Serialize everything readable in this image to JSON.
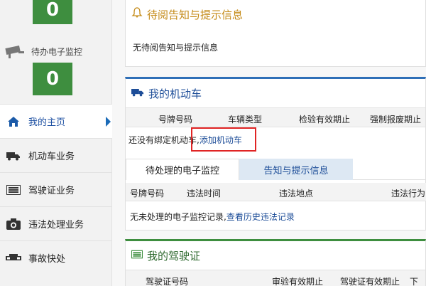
{
  "sidebar": {
    "top_count": "0",
    "monitor_label": "待办电子监控",
    "monitor_count": "0",
    "nav": [
      {
        "label": "我的主页",
        "icon": "home-icon",
        "active": true
      },
      {
        "label": "机动车业务",
        "icon": "truck-icon"
      },
      {
        "label": "驾驶证业务",
        "icon": "id-card-icon"
      },
      {
        "label": "违法处理业务",
        "icon": "camera-icon"
      },
      {
        "label": "事故快处",
        "icon": "car-icon"
      }
    ]
  },
  "notice": {
    "title": "待阅告知与提示信息",
    "content": "无待阅告知与提示信息",
    "icon": "bell-icon",
    "color": "#c48a16"
  },
  "vehicle": {
    "title": "我的机动车",
    "icon": "truck-icon",
    "columns": [
      "号牌号码",
      "车辆类型",
      "检验有效期止",
      "强制报废期止"
    ],
    "empty_text": "还没有绑定机动车,",
    "add_link": "添加机动车",
    "tabs": [
      "待处理的电子监控",
      "告知与提示信息"
    ],
    "monitor_columns": [
      "号牌号码",
      "违法时间",
      "违法地点",
      "违法行为"
    ],
    "monitor_empty": "无未处理的电子监控记录,",
    "history_link": "查看历史违法记录"
  },
  "license": {
    "title": "我的驾驶证",
    "icon": "id-card-icon",
    "columns": [
      "驾驶证号码",
      "审验有效期止",
      "驾驶证有效期止",
      "下一"
    ]
  },
  "colors": {
    "accent_blue": "#1d4d98",
    "green": "#3e8e3f",
    "highlight_red": "#e02424"
  }
}
